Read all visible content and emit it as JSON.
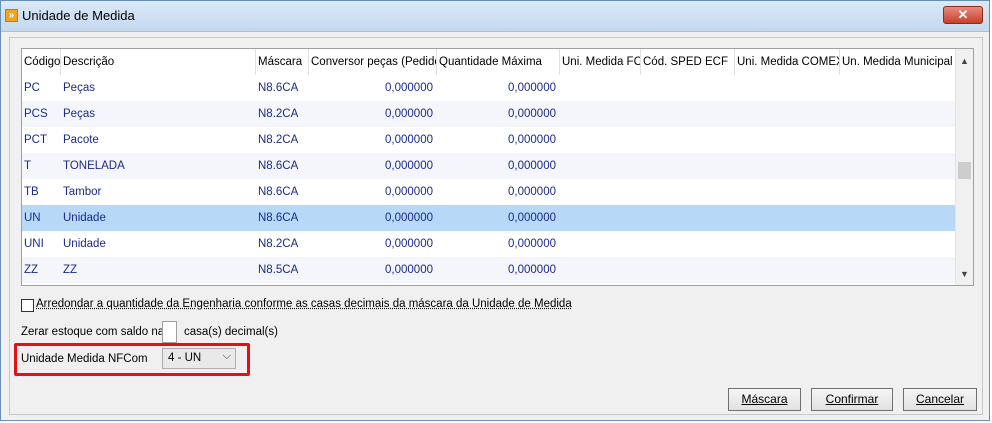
{
  "window": {
    "title": "Unidade de Medida",
    "close_glyph": "✕"
  },
  "grid": {
    "columns": [
      "Código",
      "Descrição",
      "Máscara",
      "Conversor peças (Pedido)",
      "Quantidade Máxima",
      "Uni. Medida FCI",
      "Cód. SPED ECF",
      "Uni. Medida COMEX",
      "Un. Medida Municipal"
    ],
    "rows": [
      {
        "codigo": "PC",
        "descricao": "Peças",
        "mascara": "N8.6CA",
        "conversor": "0,000000",
        "qtd_max": "0,000000"
      },
      {
        "codigo": "PCS",
        "descricao": "Peças",
        "mascara": "N8.2CA",
        "conversor": "0,000000",
        "qtd_max": "0,000000"
      },
      {
        "codigo": "PCT",
        "descricao": "Pacote",
        "mascara": "N8.2CA",
        "conversor": "0,000000",
        "qtd_max": "0,000000"
      },
      {
        "codigo": "T",
        "descricao": "TONELADA",
        "mascara": "N8.6CA",
        "conversor": "0,000000",
        "qtd_max": "0,000000"
      },
      {
        "codigo": "TB",
        "descricao": "Tambor",
        "mascara": "N8.6CA",
        "conversor": "0,000000",
        "qtd_max": "0,000000"
      },
      {
        "codigo": "UN",
        "descricao": "Unidade",
        "mascara": "N8.6CA",
        "conversor": "0,000000",
        "qtd_max": "0,000000"
      },
      {
        "codigo": "UNI",
        "descricao": "Unidade",
        "mascara": "N8.2CA",
        "conversor": "0,000000",
        "qtd_max": "0,000000"
      },
      {
        "codigo": "ZZ",
        "descricao": "ZZ",
        "mascara": "N8.5CA",
        "conversor": "0,000000",
        "qtd_max": "0,000000"
      }
    ],
    "selected_row": 5
  },
  "options": {
    "arredondar_label": "Arredondar a quantidade da Engenharia conforme as casas decimais da máscara da Unidade de Medida",
    "arredondar_checked": false,
    "zerar_label": "Zerar estoque com saldo na",
    "zerar_value": "",
    "casas_label": "casa(s) decimal(s)",
    "nfcom_label": "Unidade Medida NFCom",
    "nfcom_value": "4 - UN"
  },
  "buttons": {
    "mascara": "Máscara",
    "confirmar": "Confirmar",
    "cancelar": "Cancelar"
  },
  "colors": {
    "highlight": "#e3101a",
    "selected_row": "#b7d9f7",
    "cell_text": "#1b2a8a"
  }
}
